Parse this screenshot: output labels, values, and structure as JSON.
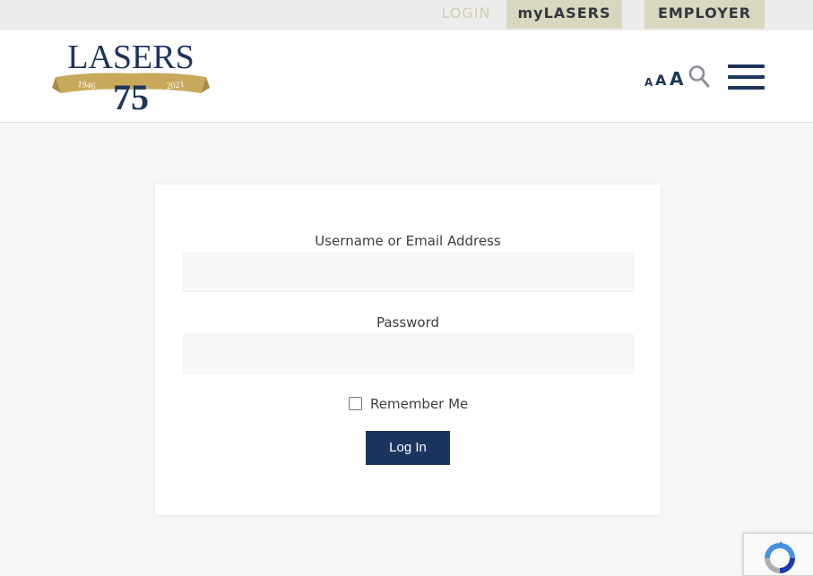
{
  "topnav": {
    "login": "LOGIN",
    "mylasers": "myLASERS",
    "employer": "EMPLOYER"
  },
  "logo": {
    "wordmark": "LASERS",
    "number": "75",
    "year_start": "1946",
    "year_end": "2021"
  },
  "header": {
    "font_small": "A",
    "font_medium": "A",
    "font_large": "A",
    "icons": [
      "search-icon",
      "menu-icon"
    ]
  },
  "form": {
    "username_label": "Username or Email Address",
    "username_value": "",
    "password_label": "Password",
    "password_value": "",
    "remember_label": "Remember Me",
    "remember_checked": false,
    "submit_label": "Log In"
  },
  "colors": {
    "navy": "#1c355e",
    "gold": "#c8a95c",
    "tan": "#d9d7bf"
  }
}
